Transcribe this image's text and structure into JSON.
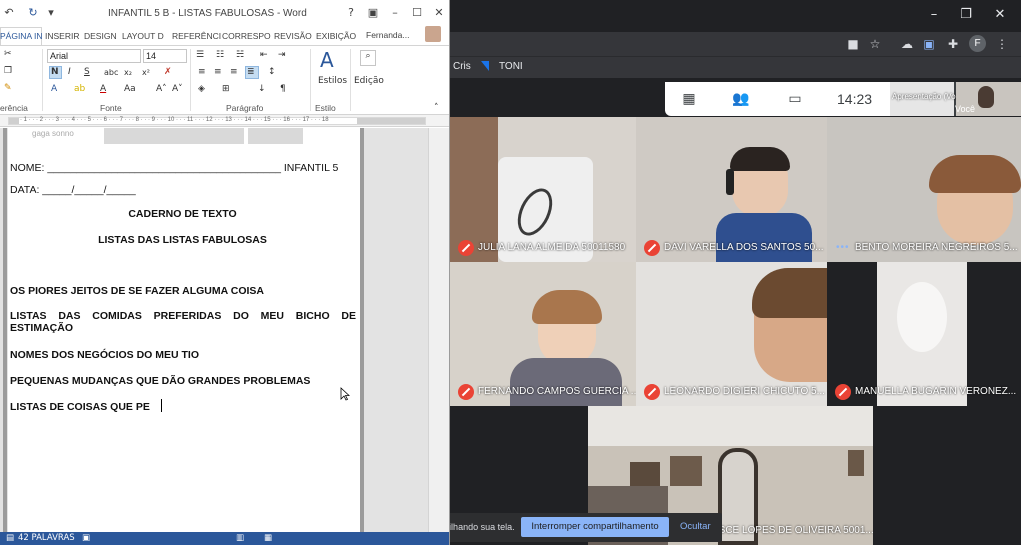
{
  "word": {
    "title": "INFANTIL 5 B - LISTAS FABULOSAS - Word",
    "tabs": [
      "PÁGINA IN",
      "INSERIR",
      "DESIGN",
      "LAYOUT D",
      "REFERÊNCI",
      "CORRESPO",
      "REVISÃO",
      "EXIBIÇÃO"
    ],
    "user_name": "Fernanda...",
    "font_name": "Arial",
    "font_size": "14",
    "group_labels": {
      "clipboard": "erência",
      "font": "Fonte",
      "paragraph": "Parágrafo",
      "styles": "Estilo"
    },
    "styles_label": "Estilos",
    "editing_label": "Edição",
    "ruler_digits": "· 1 · · · 2 · · · 3 · · · 4 · · · 5 · · · 6 · · · 7 · · · 8 · · · 9 · · · 10 · · · 11 · · · 12 · · · 13 · · · 14 · · · 15 · · · 16 · · · 17 · · · 18",
    "header_logo_text": "gaga sonno",
    "document": {
      "name_line": "NOME: ________________________________________ INFANTIL 5",
      "date_line": "DATA: _____/_____/_____",
      "heading1": "CADERNO DE TEXTO",
      "heading2": "LISTAS DAS LISTAS FABULOSAS",
      "items": [
        "OS PIORES JEITOS DE SE FAZER ALGUMA COISA",
        "LISTAS DAS COMIDAS PREFERIDAS DO MEU BICHO DE ESTIMAÇÃO",
        "NOMES DOS NEGÓCIOS DO MEU TIO",
        "PEQUENAS MUDANÇAS QUE DÃO GRANDES PROBLEMAS",
        "LISTAS DE COISAS QUE PE"
      ]
    },
    "status": {
      "words": "42 PALAVRAS"
    }
  },
  "chrome": {
    "bookmarks": [
      "Cris",
      "TONI"
    ]
  },
  "meet": {
    "time": "14:23",
    "presenter_label": "Apresentação (Você)",
    "you_label": "Você",
    "participants": [
      {
        "name": "JULIA LANA ALMEIDA 50011580"
      },
      {
        "name": "DAVI VARELLA DOS SANTOS 50..."
      },
      {
        "name": "BENTO MOREIRA NEGREIROS 5..."
      },
      {
        "name": "FERNANDO CAMPOS GUERCIA ..."
      },
      {
        "name": "LEONARDO DIGIERI CHICUTO 5..."
      },
      {
        "name": "MANUELLA BUGARIN VERONEZ..."
      },
      {
        "name": "ESCE LOPES DE OLIVEIRA 5001..."
      }
    ],
    "share_banner": {
      "text": "O meet.google.com está compartilhando sua tela.",
      "stop_label": "Interromper compartilhamento",
      "hide_label": "Ocultar"
    }
  },
  "colors": {
    "word_blue": "#2b579a",
    "meet_bg": "#202124",
    "mic_off_red": "#ea4335",
    "link_blue": "#8ab4f8"
  }
}
